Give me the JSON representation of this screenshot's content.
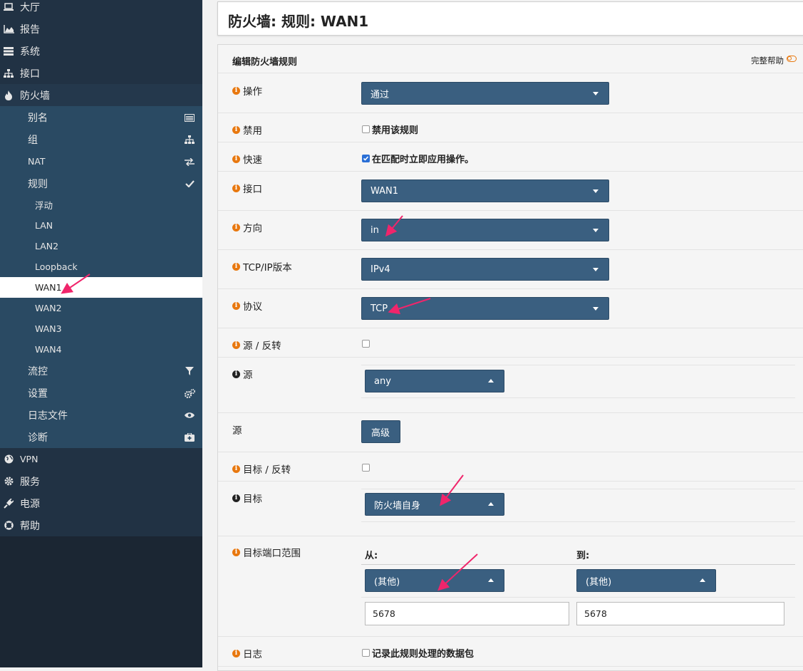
{
  "sidebar": {
    "items": [
      {
        "label": "大厅",
        "icon": "laptop-icon",
        "level": "top"
      },
      {
        "label": "报告",
        "icon": "area-chart-icon",
        "level": "top"
      },
      {
        "label": "系统",
        "icon": "server-icon",
        "level": "top"
      },
      {
        "label": "接口",
        "icon": "sitemap-icon",
        "level": "top"
      },
      {
        "label": "防火墙",
        "icon": "fire-icon",
        "level": "top-open"
      }
    ],
    "sub": [
      {
        "label": "别名",
        "icon": "list-alt-icon"
      },
      {
        "label": "组",
        "icon": "sitemap-icon"
      },
      {
        "label": "NAT",
        "icon": "exchange-icon"
      },
      {
        "label": "规则",
        "icon": "check-icon"
      }
    ],
    "rules": [
      "浮动",
      "LAN",
      "LAN2",
      "Loopback",
      "WAN1",
      "WAN2",
      "WAN3",
      "WAN4"
    ],
    "active_rule": "WAN1",
    "sub2": [
      {
        "label": "流控",
        "icon": "filter-icon"
      },
      {
        "label": "设置",
        "icon": "gears-icon"
      },
      {
        "label": "日志文件",
        "icon": "eye-icon"
      },
      {
        "label": "诊断",
        "icon": "medkit-icon"
      }
    ],
    "bottom": [
      {
        "label": "VPN",
        "icon": "globe-icon"
      },
      {
        "label": "服务",
        "icon": "cog-icon"
      },
      {
        "label": "电源",
        "icon": "plug-icon"
      },
      {
        "label": "帮助",
        "icon": "life-ring-icon"
      }
    ]
  },
  "page_title": "防火墙: 规则: WAN1",
  "form": {
    "section_title": "编辑防火墙规则",
    "full_help": "完整帮助",
    "action": {
      "label": "操作",
      "value": "通过"
    },
    "disabled": {
      "label": "禁用",
      "checkbox_text": "禁用该规则",
      "checked": false
    },
    "quick": {
      "label": "快速",
      "checkbox_text": "在匹配时立即应用操作。",
      "checked": true
    },
    "interface": {
      "label": "接口",
      "value": "WAN1"
    },
    "direction": {
      "label": "方向",
      "value": "in"
    },
    "ipversion": {
      "label": "TCP/IP版本",
      "value": "IPv4"
    },
    "protocol": {
      "label": "协议",
      "value": "TCP"
    },
    "source_invert": {
      "label": "源 / 反转"
    },
    "source": {
      "label": "源",
      "value": "any"
    },
    "source_adv": {
      "label": "源",
      "button": "高级"
    },
    "dest_invert": {
      "label": "目标 / 反转"
    },
    "dest": {
      "label": "目标",
      "value": "防火墙自身"
    },
    "dest_port": {
      "label": "目标端口范围",
      "from_label": "从:",
      "to_label": "到:",
      "from_select": "(其他)",
      "to_select": "(其他)",
      "from_value": "5678",
      "to_value": "5678"
    },
    "log": {
      "label": "日志",
      "checkbox_text": "记录此规则处理的数据包"
    }
  },
  "colors": {
    "accent": "#e8780f",
    "select_bg": "#3a5f80",
    "sidebar_bg": "#1b2633",
    "annotation_arrow": "#f0256b"
  }
}
